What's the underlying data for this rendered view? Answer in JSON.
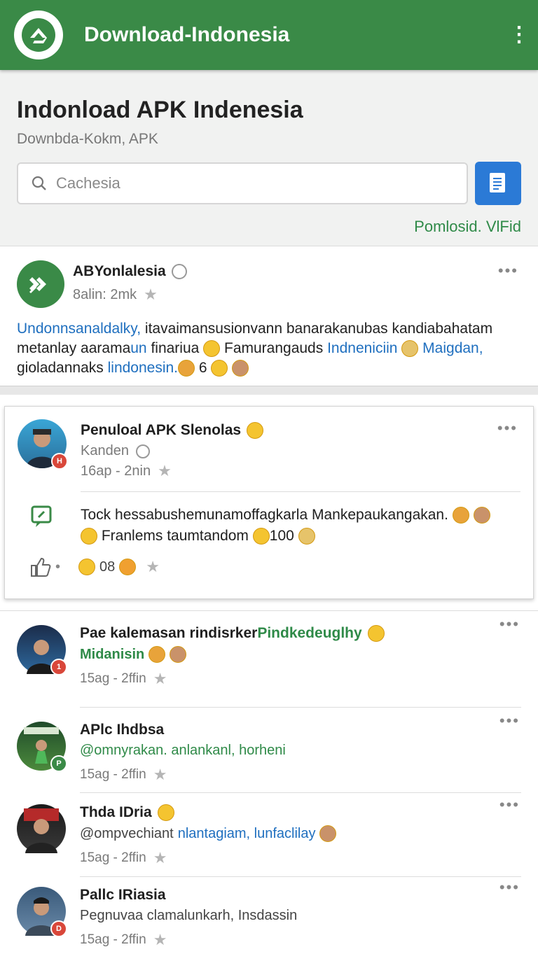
{
  "appbar": {
    "title": "Download-Indonesia"
  },
  "header": {
    "title": "Indonload APK Indenesia",
    "subtitle": "Downbda-Kokm, APK",
    "search_placeholder": "Cachesia",
    "promo": "Pomlosid. VlFid"
  },
  "post1": {
    "name": "ABYonlalesia",
    "time": "8alin: 2mk",
    "body_part1": "Undonnsanaldalky,",
    "body_part2": " itavaimansusionvann banarakanubas kandiabahatam metanlay aarama",
    "body_part3": "un",
    "body_part4": " finariua ",
    "body_part5": " Famurangauds ",
    "body_part6": "Indneniciin",
    "body_part7": " ",
    "body_part8": "Maigdan,",
    "body_part9": " gioladannaks ",
    "body_part10": "lindonesin.",
    "body_count": "6"
  },
  "card": {
    "name": "Penuloal APK Slenolas",
    "user": "Kanden",
    "time": "16ap - 2nin",
    "body_line1": "Tock hessabushemunamoffagkarla Mankepaukangakan.",
    "body_line2": "Franlems taumtandom",
    "body_count": "100",
    "reaction_count": "08"
  },
  "list": [
    {
      "name": "Pae kalemasan rindisrker ",
      "name_green": "Pindkedeuglhy",
      "sub": "Midanisin",
      "time": "15ag - 2ffin",
      "badge": "1",
      "badge_color": "#d9473a"
    },
    {
      "name": "APlc Ihdbsa",
      "sub": "@omnyrakan. anlankanl, horheni",
      "time": "15ag - 2ffin",
      "badge": "P",
      "badge_color": "#3a8a47"
    },
    {
      "name": "Thda IDria",
      "sub_gray": "@ompvechiant ",
      "sub_blue": "nlantagiam, lunfaclilay",
      "time": "15ag - 2ffin",
      "badge": "",
      "badge_color": ""
    },
    {
      "name": "Pallc IRiasia",
      "sub": "Pegnuvaa clamalunkarh, Insdassin",
      "time": "15ag - 2ffin",
      "badge": "D",
      "badge_color": "#d9473a"
    }
  ]
}
